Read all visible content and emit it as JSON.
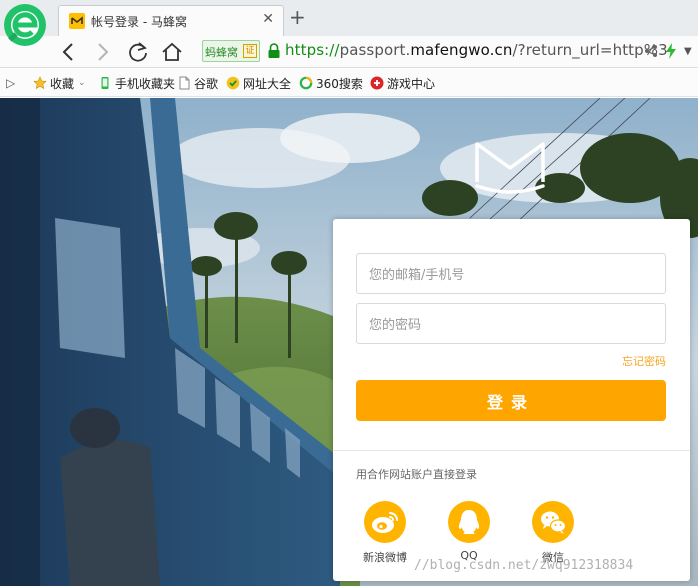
{
  "tab": {
    "title": "帐号登录 - 马蜂窝"
  },
  "address_bar": {
    "site_badge": "蚂蜂窝",
    "site_badge_cert": "证",
    "url_scheme": "https://",
    "url_host_prefix": "passport.",
    "url_host": "mafengwo.cn",
    "url_path": "/?return_url=http%3"
  },
  "bookmarks": {
    "toggle": "▷",
    "items": [
      "收藏",
      "手机收藏夹",
      "谷歌",
      "网址大全",
      "360搜索",
      "游戏中心"
    ]
  },
  "login": {
    "account_placeholder": "您的邮箱/手机号",
    "password_placeholder": "您的密码",
    "forgot_password": "忘记密码",
    "submit": "登录",
    "social_title": "用合作网站账户直接登录",
    "social": [
      {
        "label": "新浪微博",
        "icon": "weibo-icon"
      },
      {
        "label": "QQ",
        "icon": "qq-icon"
      },
      {
        "label": "微信",
        "icon": "wechat-icon"
      }
    ]
  },
  "watermark": "//blog.csdn.net/zwq912318834",
  "colors": {
    "accent": "#ffa500",
    "secure_green": "#128d16"
  }
}
